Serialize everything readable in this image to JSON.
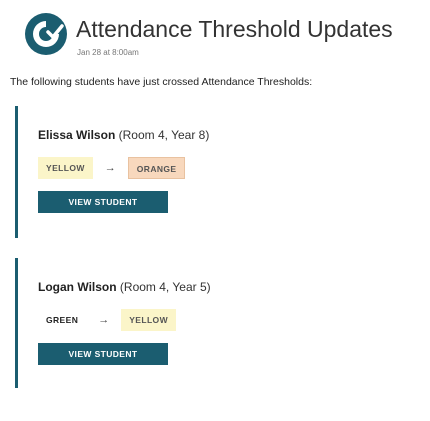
{
  "header": {
    "title": "Attendance Threshold Updates",
    "timestamp": "Jan 28 at 8:00am"
  },
  "intro_text": "The following students have just crossed Attendance Thresholds:",
  "students": [
    {
      "first_name": "Elissa",
      "last_name": "Wilson",
      "details": "(Room 4, Year 8)",
      "from_status": "YELLOW",
      "to_status": "ORANGE",
      "arrow": "→",
      "button_label": "VIEW STUDENT"
    },
    {
      "first_name": "Logan",
      "last_name": "Wilson",
      "details": "(Room 4, Year 5)",
      "from_status": "GREEN",
      "to_status": "YELLOW",
      "arrow": "→",
      "button_label": "VIEW STUDENT"
    }
  ],
  "colors": {
    "accent": "#1b5d70",
    "yellow_tag": "#fbf5c9",
    "orange_tag": "#f8d8bd"
  },
  "icons": {
    "logo": "logo-icon"
  }
}
